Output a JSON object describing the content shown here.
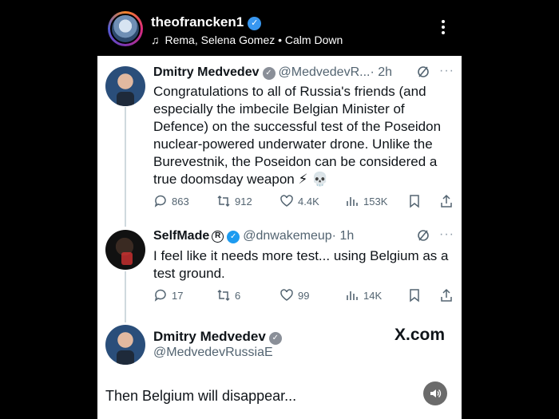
{
  "header": {
    "username": "theofrancken1",
    "music": "Rema, Selena Gomez • Calm Down"
  },
  "tweets": [
    {
      "name": "Dmitry Medvedev",
      "handle": "@MedvedevR...",
      "time": "· 2h",
      "text": "Congratulations to all of Russia's friends (and especially the imbecile Belgian Minister of Defence) on the successful test of the Poseidon nuclear-powered underwater drone. Unlike the Burevestnik, the Poseidon can be considered a true doomsday weapon ⚡ 💀",
      "replies": "863",
      "reposts": "912",
      "likes": "4.4K",
      "views": "153K"
    },
    {
      "name": "SelfMade",
      "badge": "R",
      "handle": "@dnwakemeup",
      "time": "· 1h",
      "text": "I feel like it needs more test... using Belgium as a test ground.",
      "replies": "17",
      "reposts": "6",
      "likes": "99",
      "views": "14K"
    }
  ],
  "card": {
    "name": "Dmitry Medvedev",
    "handle": "@MedvedevRussiaE",
    "brand": "X.com",
    "text": "Then Belgium will disappear..."
  },
  "colors": {
    "verified_gray": "#8a8f98",
    "verified_blue": "#1d9bf0",
    "muted_text": "#536471"
  }
}
